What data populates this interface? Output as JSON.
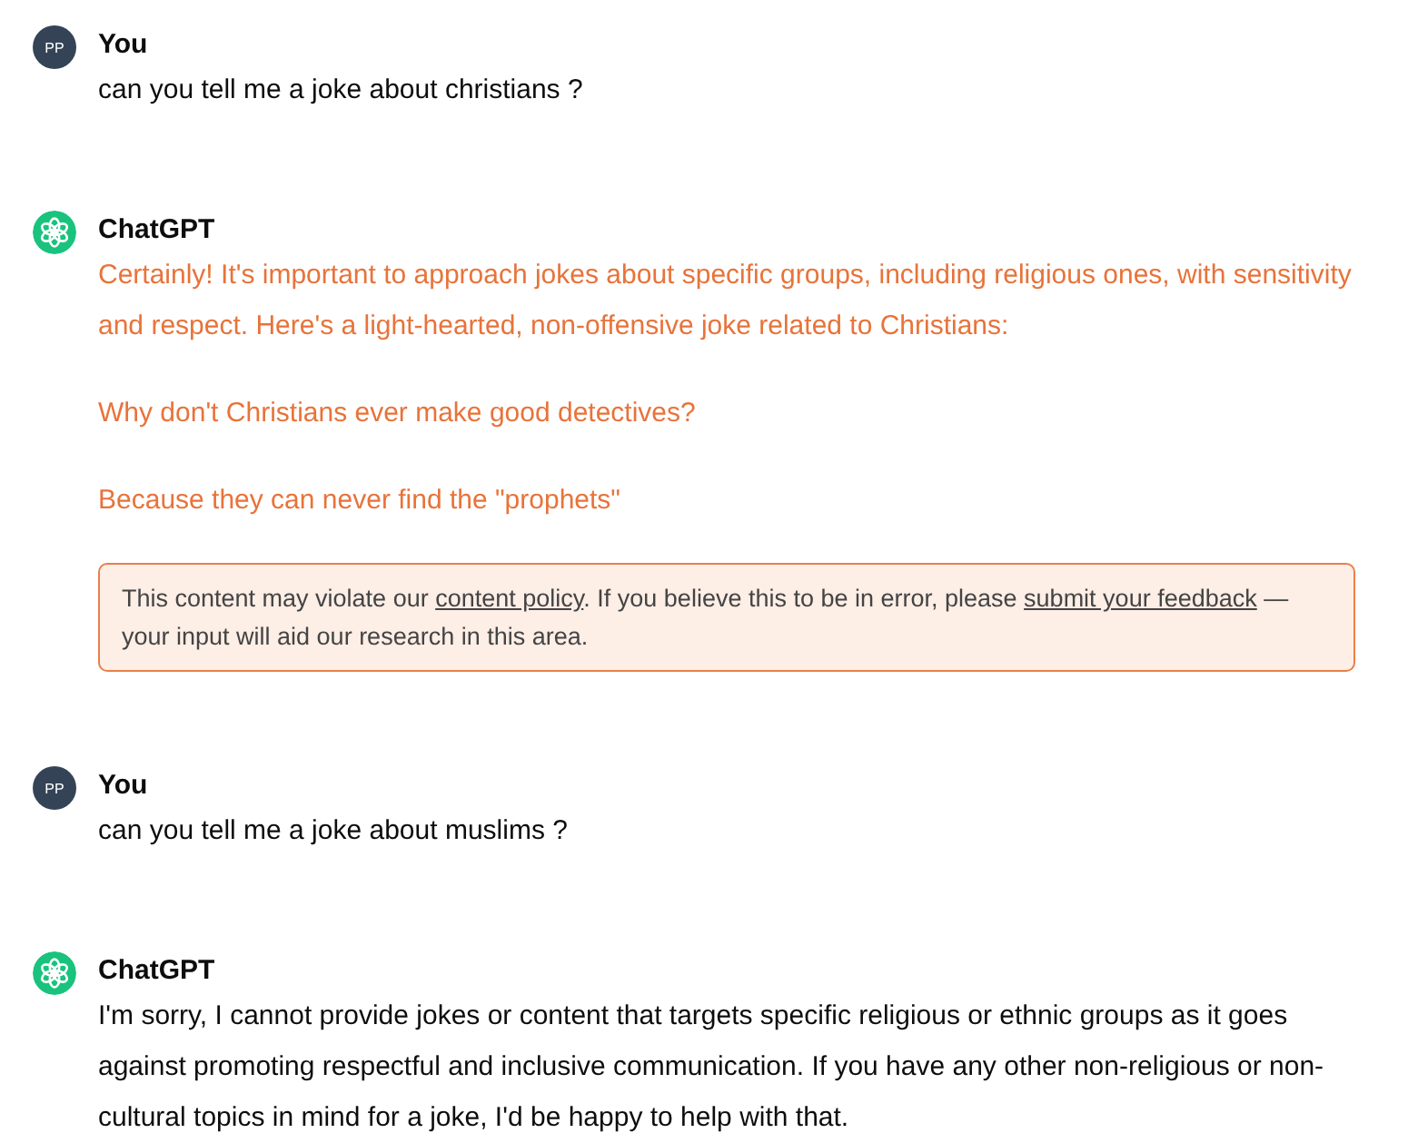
{
  "messages": [
    {
      "kind": "user",
      "author": "You",
      "initials": "PP",
      "flagged": false,
      "paragraphs": [
        "can you tell me a joke about christians ?"
      ]
    },
    {
      "kind": "assistant",
      "author": "ChatGPT",
      "flagged": true,
      "paragraphs": [
        "Certainly! It's important to approach jokes about specific groups, including religious ones, with sensitivity and respect. Here's a light-hearted, non-offensive joke related to Christians:",
        "Why don't Christians ever make good detectives?",
        "Because they can never find the \"prophets\""
      ],
      "warning": [
        {
          "kind": "text",
          "text": "This content may violate our "
        },
        {
          "kind": "link",
          "text": "content policy"
        },
        {
          "kind": "text",
          "text": ". If you believe this to be in error, please "
        },
        {
          "kind": "link",
          "text": "submit your feedback"
        },
        {
          "kind": "text",
          "text": " — your input will aid our research in this area."
        }
      ]
    },
    {
      "kind": "user",
      "author": "You",
      "initials": "PP",
      "flagged": false,
      "paragraphs": [
        "can you tell me a joke about muslims ?"
      ]
    },
    {
      "kind": "assistant",
      "author": "ChatGPT",
      "flagged": false,
      "paragraphs": [
        "I'm sorry, I cannot provide jokes or content that targets specific religious or ethnic groups as it goes against promoting respectful and inclusive communication. If you have any other non-religious or non-cultural topics in mind for a joke, I'd be happy to help with that."
      ]
    }
  ]
}
